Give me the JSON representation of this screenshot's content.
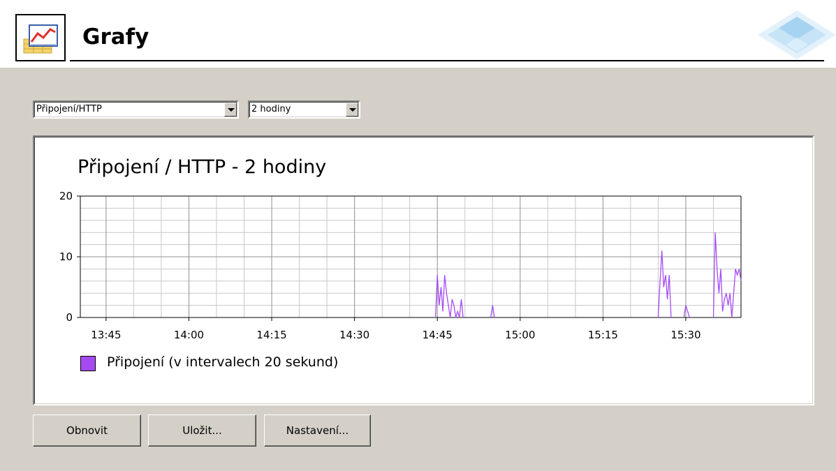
{
  "header": {
    "title": "Grafy",
    "icon": "chart-icon",
    "logo": "logo-icon"
  },
  "controls": {
    "type_select": {
      "value": "Připojení/HTTP"
    },
    "range_select": {
      "value": "2 hodiny"
    }
  },
  "buttons": {
    "refresh": "Obnovit",
    "save": "Uložit...",
    "settings": "Nastavení..."
  },
  "colors": {
    "background": "#d4d0c8",
    "series": "#a64bf4",
    "grid": "#c8c8c8"
  },
  "chart_data": {
    "type": "area",
    "title": "Připojení / HTTP - 2 hodiny",
    "xlabel": "",
    "ylabel": "",
    "ylim": [
      0,
      20
    ],
    "yticks": [
      "0",
      "10",
      "20"
    ],
    "xticks": [
      "13:45",
      "14:00",
      "14:15",
      "14:30",
      "14:45",
      "15:00",
      "15:15",
      "15:30"
    ],
    "xlim": [
      "13:40:20",
      "15:40:00"
    ],
    "grid": true,
    "legend": "bottom-left",
    "series": [
      {
        "name": "Připojení (v intervalech 20 sekund)",
        "points": [
          [
            "14:44:40",
            0
          ],
          [
            "14:45:00",
            7
          ],
          [
            "14:45:20",
            2
          ],
          [
            "14:45:40",
            5
          ],
          [
            "14:46:00",
            1
          ],
          [
            "14:46:20",
            7
          ],
          [
            "14:46:40",
            4
          ],
          [
            "14:47:00",
            2
          ],
          [
            "14:47:20",
            0
          ],
          [
            "14:47:40",
            3
          ],
          [
            "14:48:00",
            2
          ],
          [
            "14:48:20",
            0
          ],
          [
            "14:48:40",
            1
          ],
          [
            "14:49:00",
            0
          ],
          [
            "14:49:20",
            3
          ],
          [
            "14:49:40",
            0
          ],
          [
            "14:54:40",
            0
          ],
          [
            "14:55:00",
            2
          ],
          [
            "14:55:20",
            0
          ],
          [
            "15:25:00",
            0
          ],
          [
            "15:25:20",
            6
          ],
          [
            "15:25:40",
            11
          ],
          [
            "15:26:00",
            5
          ],
          [
            "15:26:20",
            7
          ],
          [
            "15:26:40",
            3
          ],
          [
            "15:27:00",
            7
          ],
          [
            "15:27:20",
            0
          ],
          [
            "15:29:40",
            0
          ],
          [
            "15:30:00",
            2
          ],
          [
            "15:30:20",
            1
          ],
          [
            "15:30:40",
            0
          ],
          [
            "15:35:00",
            0
          ],
          [
            "15:35:20",
            14
          ],
          [
            "15:35:40",
            8
          ],
          [
            "15:36:00",
            4
          ],
          [
            "15:36:20",
            8
          ],
          [
            "15:36:40",
            1
          ],
          [
            "15:37:00",
            3
          ],
          [
            "15:37:20",
            4
          ],
          [
            "15:37:40",
            2
          ],
          [
            "15:38:00",
            4
          ],
          [
            "15:38:20",
            0
          ],
          [
            "15:38:40",
            4
          ],
          [
            "15:39:00",
            8
          ],
          [
            "15:39:20",
            7
          ],
          [
            "15:39:40",
            8
          ],
          [
            "15:40:00",
            6
          ]
        ]
      }
    ]
  }
}
